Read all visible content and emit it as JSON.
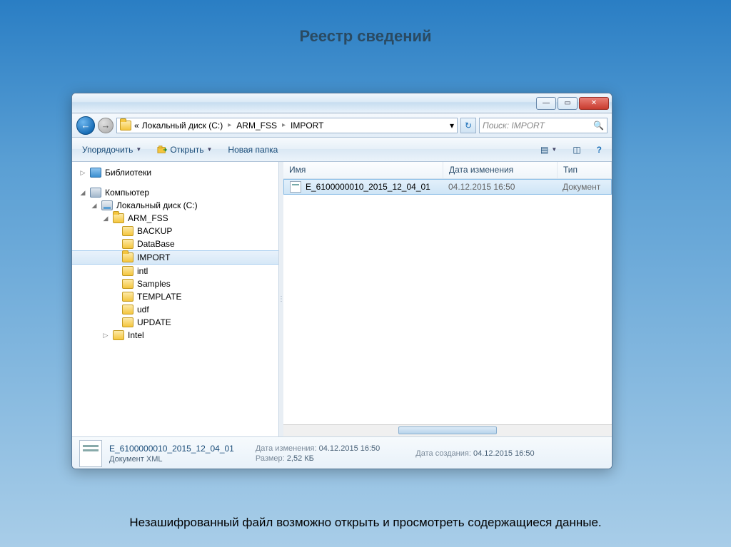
{
  "slide": {
    "title": "Реестр сведений",
    "caption": "Незашифрованный файл возможно открыть и просмотреть содержащиеся данные."
  },
  "titlebar": {
    "minimize": "—",
    "maximize": "▭",
    "close": "✕"
  },
  "address": {
    "back": "←",
    "forward": "→",
    "chevrons": "«",
    "crumb1": "Локальный диск (C:)",
    "crumb2": "ARM_FSS",
    "crumb3": "IMPORT",
    "sep": "▸",
    "dropdown": "▾",
    "refresh": "↻",
    "search_placeholder": "Поиск: IMPORT",
    "search_icon": "🔍"
  },
  "toolbar": {
    "organize": "Упорядочить",
    "open": "Открыть",
    "newfolder": "Новая папка",
    "caret": "▼",
    "help": "?"
  },
  "tree": {
    "libraries": "Библиотеки",
    "computer": "Компьютер",
    "disk": "Локальный диск (C:)",
    "arm": "ARM_FSS",
    "items": [
      "BACKUP",
      "DataBase",
      "IMPORT",
      "intl",
      "Samples",
      "TEMPLATE",
      "udf",
      "UPDATE"
    ],
    "intel": "Intel"
  },
  "columns": {
    "name": "Имя",
    "date": "Дата изменения",
    "type": "Тип"
  },
  "files": {
    "row0": {
      "name": "E_6100000010_2015_12_04_01",
      "date": "04.12.2015 16:50",
      "type": "Документ"
    }
  },
  "details": {
    "filename": "E_6100000010_2015_12_04_01",
    "filetype": "Документ XML",
    "modified_label": "Дата изменения:",
    "modified": "04.12.2015 16:50",
    "size_label": "Размер:",
    "size": "2,52 КБ",
    "created_label": "Дата создания:",
    "created": "04.12.2015 16:50"
  }
}
